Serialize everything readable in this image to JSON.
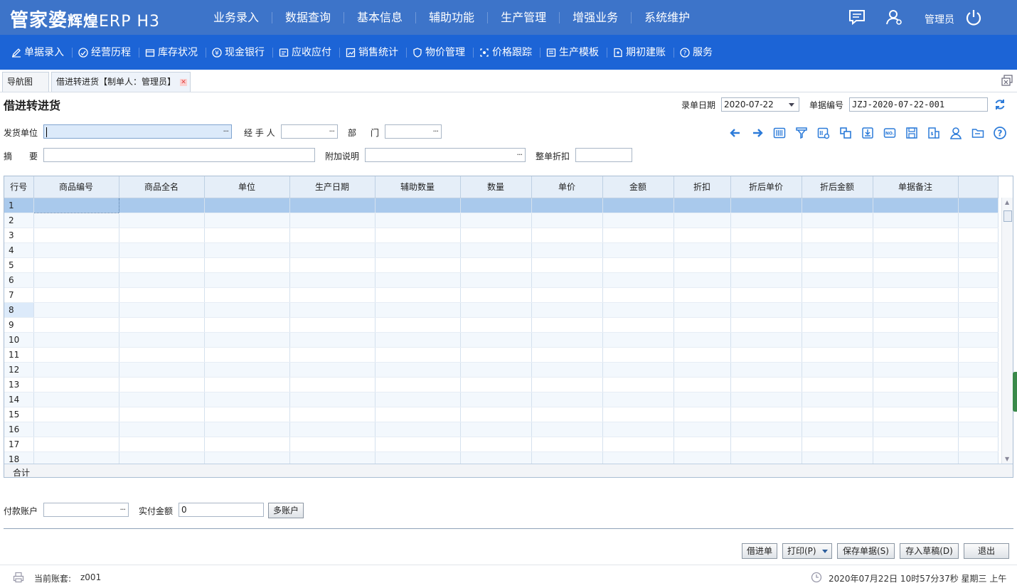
{
  "app": {
    "brand_main": "管家婆",
    "brand_sub": "辉煌",
    "brand_ver": "ERP H3",
    "user_label": "管理员"
  },
  "main_menu": [
    "业务录入",
    "数据查询",
    "基本信息",
    "辅助功能",
    "生产管理",
    "增强业务",
    "系统维护"
  ],
  "sub_menu": [
    "单据录入",
    "经营历程",
    "库存状况",
    "现金银行",
    "应收应付",
    "销售统计",
    "物价管理",
    "价格跟踪",
    "生产模板",
    "期初建账",
    "服务"
  ],
  "tabs": {
    "nav": "导航图",
    "active": "借进转进货【制单人：管理员】"
  },
  "form": {
    "title": "借进转进货",
    "date_label": "录单日期",
    "date_value": "2020-07-22",
    "bill_no_label": "单据编号",
    "bill_no_value": "JZJ-2020-07-22-001",
    "supplier_label": "发货单位",
    "handler_label": "经 手 人",
    "dept_label_1": "部",
    "dept_label_2": "门",
    "summary_label_1": "摘",
    "summary_label_2": "要",
    "extra_label": "附加说明",
    "discount_label": "整单折扣",
    "dots": "···"
  },
  "grid": {
    "columns": [
      "行号",
      "商品编号",
      "商品全名",
      "单位",
      "生产日期",
      "辅助数量",
      "数量",
      "单价",
      "金额",
      "折扣",
      "折后单价",
      "折后金额",
      "单据备注"
    ],
    "rows": [
      "1",
      "2",
      "3",
      "4",
      "5",
      "6",
      "7",
      "8",
      "9",
      "10",
      "11",
      "12",
      "13",
      "14",
      "15",
      "16",
      "17",
      "18"
    ],
    "total_label": "合计"
  },
  "payment": {
    "account_label": "付款账户",
    "paid_label": "实付金额",
    "paid_value": "0",
    "multi_button": "多账户"
  },
  "buttons": {
    "borrow": "借进单",
    "print": "打印(P)",
    "save": "保存单据(S)",
    "draft": "存入草稿(D)",
    "exit": "退出"
  },
  "status": {
    "account_label": "当前账套:",
    "account_value": "z001",
    "datetime": "2020年07月22日 10时57分37秒 星期三 上午"
  },
  "colors": {
    "topbar": "#3d74c9",
    "subbar": "#1c64d6",
    "icon_blue": "#2c7bd9",
    "row_selected": "#a9c9ec"
  }
}
